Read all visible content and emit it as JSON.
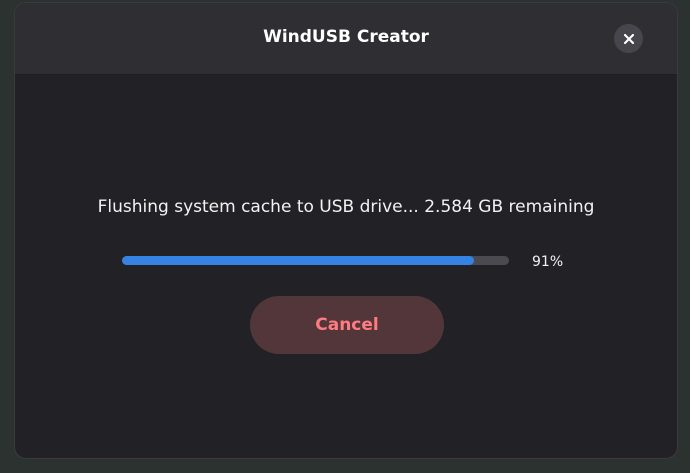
{
  "window": {
    "title": "WindUSB Creator",
    "close_icon": "close-icon"
  },
  "progress": {
    "status_text": "Flushing system cache to USB drive... 2.584 GB remaining",
    "percent": 91,
    "percent_label": "91%"
  },
  "actions": {
    "cancel_label": "Cancel"
  },
  "colors": {
    "accent": "#3584e4",
    "destructive_text": "#ff7b80",
    "destructive_bg": "#52363a"
  }
}
